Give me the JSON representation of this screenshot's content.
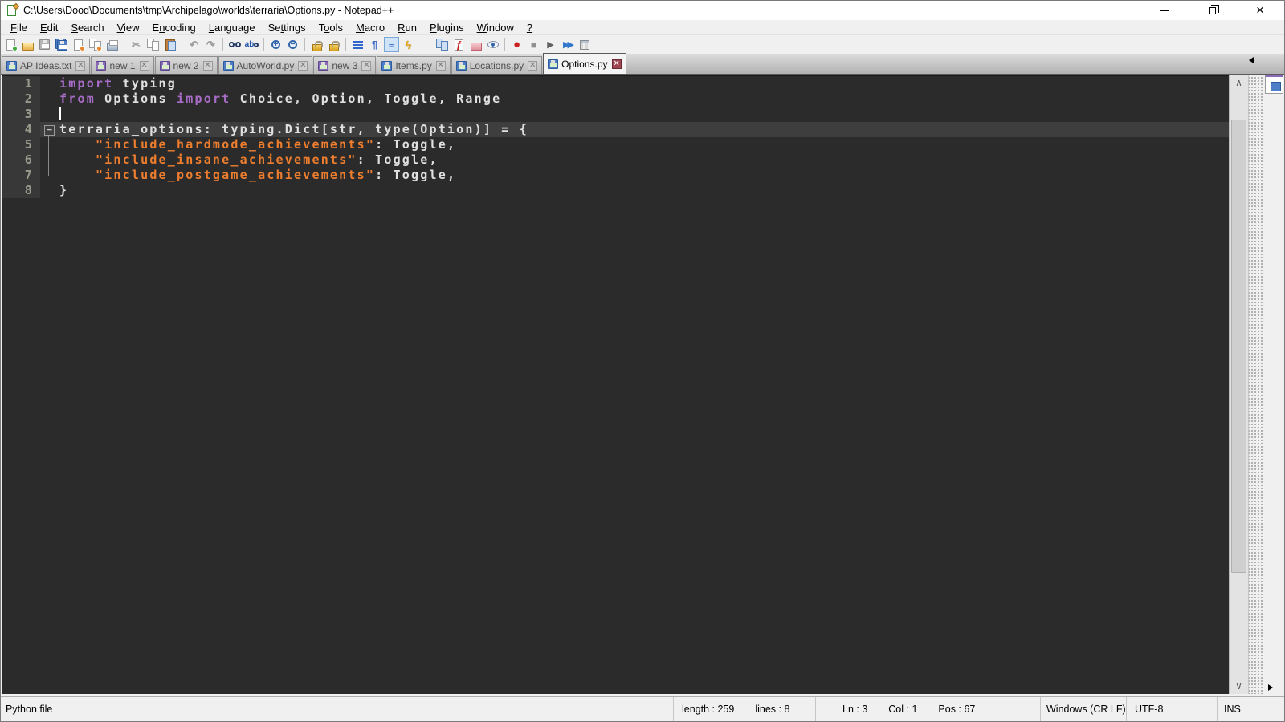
{
  "colors": {
    "titlebar_bg": "#ffffff",
    "chrome_bg": "#f0f0f0",
    "tab_active_bg": "#f4f4f4",
    "tab_inactive_text": "#4f4f4f",
    "tab_close_active_bg": "#a04552",
    "editor_bg": "#2b2b2b",
    "margin_bg": "#383838",
    "current_line_bg": "#3e3e3e",
    "line_number": "#9a9a8c",
    "keyword": "#a76cc6",
    "default_text": "#dfe0e0",
    "string": "#ee7e2e",
    "caret": "#ffffff",
    "status_bg": "#f0f0f0",
    "floppy_blue": "#4f7ec9",
    "floppy_violet": "#8a6ab8"
  },
  "window": {
    "title": "C:\\Users\\Dood\\Documents\\tmp\\Archipelago\\worlds\\terraria\\Options.py - Notepad++"
  },
  "menu": {
    "items": [
      {
        "label": "File",
        "u": 0
      },
      {
        "label": "Edit",
        "u": 0
      },
      {
        "label": "Search",
        "u": 0
      },
      {
        "label": "View",
        "u": 0
      },
      {
        "label": "Encoding",
        "u": 1
      },
      {
        "label": "Language",
        "u": 0
      },
      {
        "label": "Settings",
        "u": 2
      },
      {
        "label": "Tools",
        "u": 1
      },
      {
        "label": "Macro",
        "u": 0
      },
      {
        "label": "Run",
        "u": 0
      },
      {
        "label": "Plugins",
        "u": 0
      },
      {
        "label": "Window",
        "u": 0
      },
      {
        "label": "?",
        "u": 0
      }
    ]
  },
  "toolbar": {
    "groups": [
      [
        "new-file",
        "open-file",
        "save-file",
        "save-all",
        "close-file",
        "close-all",
        "print"
      ],
      [
        "cut",
        "copy",
        "paste"
      ],
      [
        "undo",
        "redo"
      ],
      [
        "find",
        "replace"
      ],
      [
        "zoom-in",
        "zoom-out"
      ],
      [
        "sync-vertical",
        "sync-horizontal"
      ],
      [
        "word-wrap",
        "show-all-characters",
        "indent-guide",
        "function-list",
        "document-map",
        "document-switcher",
        "run-script",
        "project-folder",
        "file-monitor"
      ],
      [
        "record-macro",
        "stop-recording",
        "playback-macro",
        "run-macro-multiple",
        "save-macro"
      ]
    ],
    "pressed": [
      "indent-guide"
    ]
  },
  "tabs": [
    {
      "label": "AP Ideas.txt",
      "floppy": "blue",
      "active": false
    },
    {
      "label": "new 1",
      "floppy": "violet",
      "active": false
    },
    {
      "label": "new 2",
      "floppy": "violet",
      "active": false
    },
    {
      "label": "AutoWorld.py",
      "floppy": "blue",
      "active": false
    },
    {
      "label": "new 3",
      "floppy": "violet",
      "active": false
    },
    {
      "label": "Items.py",
      "floppy": "blue",
      "active": false
    },
    {
      "label": "Locations.py",
      "floppy": "blue",
      "active": false
    },
    {
      "label": "Options.py",
      "floppy": "blue",
      "active": true
    }
  ],
  "editor": {
    "caret_line": 3,
    "current_line": 4,
    "lines": [
      {
        "num": 1,
        "fold": "",
        "segments": [
          [
            "kw",
            "import"
          ],
          [
            "df",
            " typing"
          ]
        ]
      },
      {
        "num": 2,
        "fold": "",
        "segments": [
          [
            "kw",
            "from"
          ],
          [
            "df",
            " Options "
          ],
          [
            "kw",
            "import"
          ],
          [
            "df",
            " Choice, Option, Toggle, Range"
          ]
        ]
      },
      {
        "num": 3,
        "fold": "",
        "segments": []
      },
      {
        "num": 4,
        "fold": "box",
        "segments": [
          [
            "df",
            "terraria_options: typing.Dict[str, type(Option)] = {"
          ]
        ]
      },
      {
        "num": 5,
        "fold": "line",
        "segments": [
          [
            "df",
            "    "
          ],
          [
            "str",
            "\"include_hardmode_achievements\""
          ],
          [
            "df",
            ": Toggle,"
          ]
        ]
      },
      {
        "num": 6,
        "fold": "line",
        "segments": [
          [
            "df",
            "    "
          ],
          [
            "str",
            "\"include_insane_achievements\""
          ],
          [
            "df",
            ": Toggle,"
          ]
        ]
      },
      {
        "num": 7,
        "fold": "corner",
        "segments": [
          [
            "df",
            "    "
          ],
          [
            "str",
            "\"include_postgame_achievements\""
          ],
          [
            "df",
            ": Toggle,"
          ]
        ]
      },
      {
        "num": 8,
        "fold": "",
        "segments": [
          [
            "df",
            "}"
          ]
        ]
      }
    ]
  },
  "status_bar": {
    "doc_type": "Python file",
    "length": "length : 259",
    "lines": "lines : 8",
    "line": "Ln : 3",
    "col": "Col : 1",
    "pos": "Pos : 67",
    "eol": "Windows (CR LF)",
    "encoding": "UTF-8",
    "mode": "INS"
  }
}
